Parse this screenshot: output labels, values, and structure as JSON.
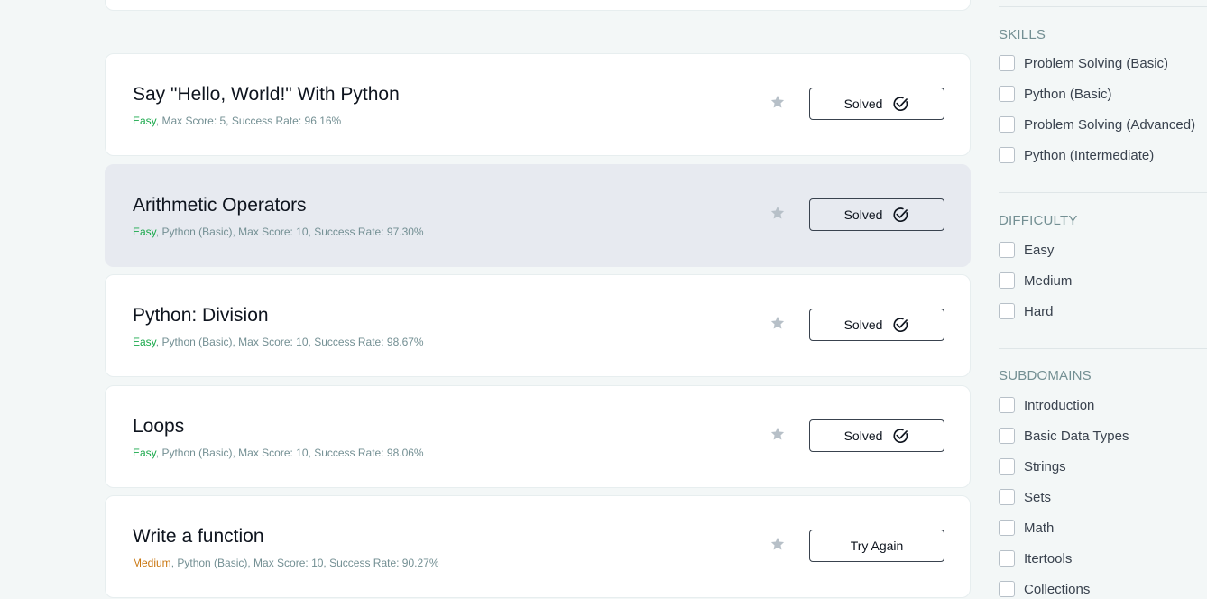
{
  "challenges": [
    {
      "title": "Say \"Hello, World!\" With Python",
      "difficulty": "Easy",
      "meta": ", Max Score: 5, Success Rate: 96.16%",
      "status": "Solved",
      "icon": "star-icon"
    },
    {
      "title": "Arithmetic Operators",
      "difficulty": "Easy",
      "meta": ", Python (Basic), Max Score: 10, Success Rate: 97.30%",
      "status": "Solved",
      "icon": "star-icon"
    },
    {
      "title": "Python: Division",
      "difficulty": "Easy",
      "meta": ", Python (Basic), Max Score: 10, Success Rate: 98.67%",
      "status": "Solved",
      "icon": "star-icon"
    },
    {
      "title": "Loops",
      "difficulty": "Easy",
      "meta": ", Python (Basic), Max Score: 10, Success Rate: 98.06%",
      "status": "Solved",
      "icon": "star-icon"
    },
    {
      "title": "Write a function",
      "difficulty": "Medium",
      "meta": ", Python (Basic), Max Score: 10, Success Rate: 90.27%",
      "status": "Try Again",
      "icon": "star-icon"
    }
  ],
  "filters": {
    "skills": {
      "title": "SKILLS",
      "options": [
        "Problem Solving (Basic)",
        "Python (Basic)",
        "Problem Solving (Advanced)",
        "Python (Intermediate)"
      ]
    },
    "difficulty": {
      "title": "DIFFICULTY",
      "options": [
        "Easy",
        "Medium",
        "Hard"
      ]
    },
    "subdomains": {
      "title": "SUBDOMAINS",
      "options": [
        "Introduction",
        "Basic Data Types",
        "Strings",
        "Sets",
        "Math",
        "Itertools",
        "Collections"
      ]
    }
  },
  "colors": {
    "easy": "#1ba94c",
    "medium": "#c9750e",
    "star": "#b7c0c8",
    "hover_card": "#e7eaf0"
  }
}
